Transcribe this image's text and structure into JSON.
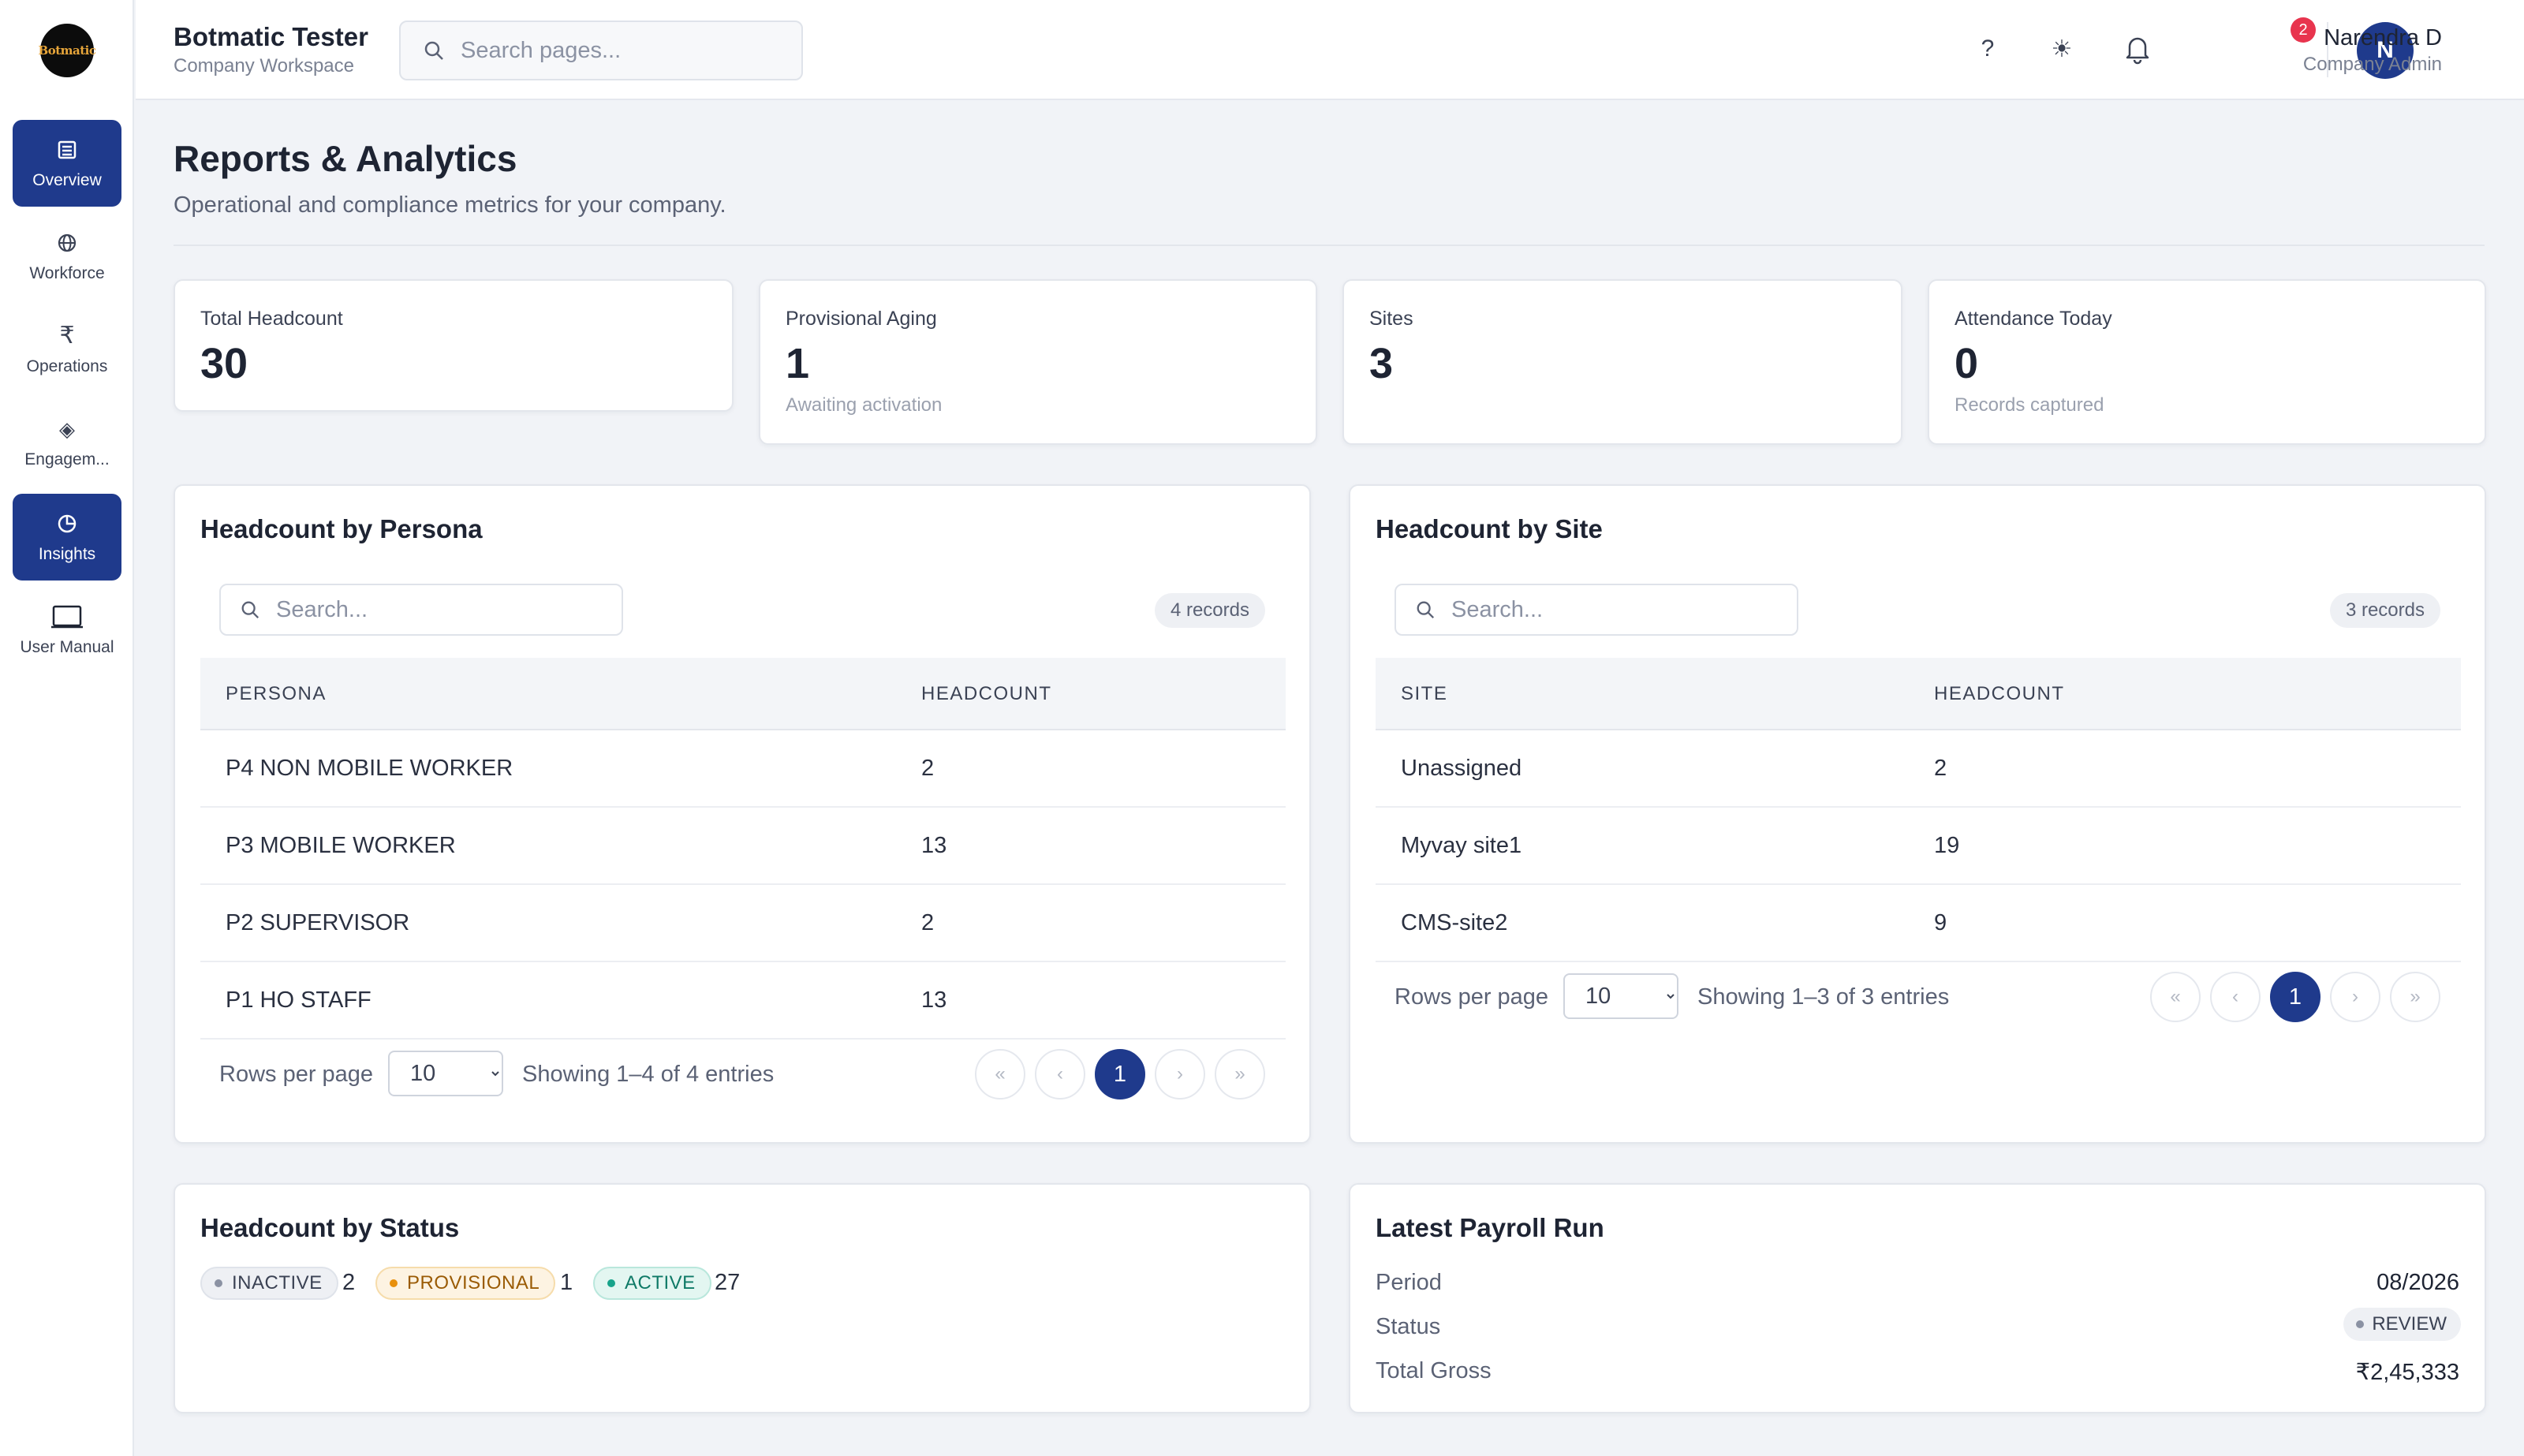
{
  "app": {
    "logo_text": "Botmatic"
  },
  "sidebar": {
    "items": [
      {
        "label": "Overview",
        "icon": "list-icon"
      },
      {
        "label": "Workforce",
        "icon": "globe-icon"
      },
      {
        "label": "Operations",
        "icon": "rupee-icon",
        "glyph": "₹"
      },
      {
        "label": "Engagem...",
        "icon": "diamond-icon",
        "glyph": "◈"
      },
      {
        "label": "Insights",
        "icon": "pie-chart-icon"
      },
      {
        "label": "User Manual",
        "icon": "book-icon"
      }
    ]
  },
  "header": {
    "workspace_title": "Botmatic Tester",
    "workspace_sub": "Company Workspace",
    "search_placeholder": "Search pages...",
    "help_glyph": "?",
    "theme_glyph": "☀",
    "notification_count": "2",
    "user": {
      "initial": "N",
      "name": "Narendra D",
      "role": "Company Admin",
      "caret": "▾"
    }
  },
  "page": {
    "title": "Reports & Analytics",
    "subtitle": "Operational and compliance metrics for your company."
  },
  "stats": [
    {
      "label": "Total Headcount",
      "value": "30",
      "note": ""
    },
    {
      "label": "Provisional Aging",
      "value": "1",
      "note": "Awaiting activation"
    },
    {
      "label": "Sites",
      "value": "3",
      "note": ""
    },
    {
      "label": "Attendance Today",
      "value": "0",
      "note": "Records captured"
    }
  ],
  "persona_table": {
    "title": "Headcount by Persona",
    "search_placeholder": "Search...",
    "records": "4 records",
    "columns": [
      "PERSONA",
      "HEADCOUNT"
    ],
    "rows": [
      [
        "P4 NON MOBILE WORKER",
        "2"
      ],
      [
        "P3 MOBILE WORKER",
        "13"
      ],
      [
        "P2 SUPERVISOR",
        "2"
      ],
      [
        "P1 HO STAFF",
        "13"
      ]
    ],
    "rows_per_page_label": "Rows per page",
    "rows_per_page": "10",
    "showing": "Showing 1–4 of 4 entries",
    "current_page": "1",
    "first": "«",
    "prev": "‹",
    "next": "›",
    "last": "»"
  },
  "site_table": {
    "title": "Headcount by Site",
    "search_placeholder": "Search...",
    "records": "3 records",
    "columns": [
      "SITE",
      "HEADCOUNT"
    ],
    "rows": [
      [
        "Unassigned",
        "2"
      ],
      [
        "Myvay site1",
        "19"
      ],
      [
        "CMS-site2",
        "9"
      ]
    ],
    "rows_per_page_label": "Rows per page",
    "rows_per_page": "10",
    "showing": "Showing 1–3 of 3 entries",
    "current_page": "1",
    "first": "«",
    "prev": "‹",
    "next": "›",
    "last": "»"
  },
  "status": {
    "title": "Headcount by Status",
    "items": [
      {
        "label": "INACTIVE",
        "count": "2",
        "color": "#8b92a3"
      },
      {
        "label": "PROVISIONAL",
        "count": "1",
        "color": "#e8900c"
      },
      {
        "label": "ACTIVE",
        "count": "27",
        "color": "#17a38a"
      }
    ]
  },
  "payroll": {
    "title": "Latest Payroll Run",
    "period_label": "Period",
    "period": "08/2026",
    "status_label": "Status",
    "status": "REVIEW",
    "gross_label": "Total Gross",
    "gross": "₹2,45,333"
  },
  "colors": {
    "accent": "#1f3a8c",
    "badge": "#e8344e"
  }
}
